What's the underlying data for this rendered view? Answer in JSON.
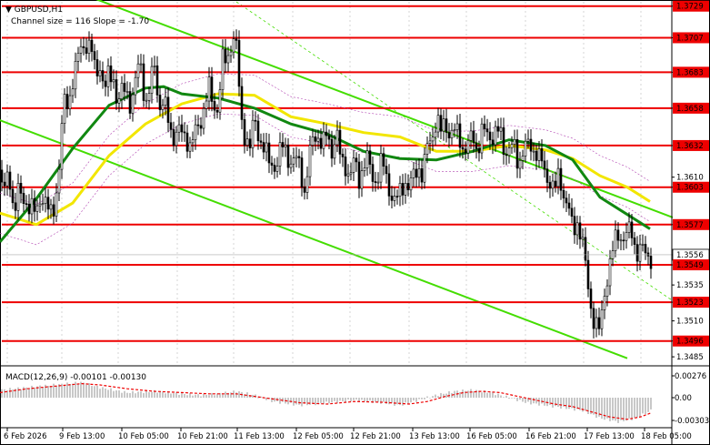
{
  "header": {
    "symbol": "▼ GBPUSD,H1",
    "channel": "Channel size = 116 Slope = -1.70"
  },
  "macd_panel": {
    "label": "MACD(12,26,9) -0.00101 -0.00130",
    "ticks": [
      "0.00276",
      "0.00",
      "-0.00303"
    ]
  },
  "x_axis_labels": [
    "6 Feb 2026",
    "9 Feb 13:00",
    "10 Feb 05:00",
    "10 Feb 21:00",
    "11 Feb 13:00",
    "12 Feb 05:00",
    "12 Feb 21:00",
    "13 Feb 13:00",
    "16 Feb 05:00",
    "16 Feb 21:00",
    "17 Feb 13:00",
    "18 Feb 05:00"
  ],
  "colors": {
    "level": "#ee0000",
    "channel": "#44dd00",
    "ma_green": "#118811",
    "ma_yellow": "#f2e600",
    "candle": "#000000",
    "macd_hist": "#c8c8c8",
    "macd_signal": "#ee0000"
  },
  "chart_data": {
    "type": "candlestick",
    "ylim": [
      1.348,
      1.3732
    ],
    "price_ticks": [
      "1.3729",
      "1.3707",
      "1.3683",
      "1.3658",
      "1.3632",
      "1.3610",
      "1.3603",
      "1.3577",
      "1.3556",
      "1.3549",
      "1.3535",
      "1.3523",
      "1.3510",
      "1.3496",
      "1.3485"
    ],
    "levels": [
      1.3729,
      1.3707,
      1.3683,
      1.3658,
      1.3632,
      1.3603,
      1.3577,
      1.3549,
      1.3523,
      1.3496
    ],
    "current_price": 1.3556,
    "close_path": [
      [
        0,
        1.3615
      ],
      [
        5,
        1.36
      ],
      [
        10,
        1.361
      ],
      [
        15,
        1.359
      ],
      [
        20,
        1.36
      ],
      [
        25,
        1.359
      ],
      [
        30,
        1.3595
      ],
      [
        35,
        1.359
      ],
      [
        40,
        1.358
      ],
      [
        45,
        1.36
      ],
      [
        50,
        1.3595
      ],
      [
        55,
        1.358
      ],
      [
        60,
        1.359
      ],
      [
        65,
        1.362
      ],
      [
        70,
        1.366
      ],
      [
        75,
        1.366
      ],
      [
        80,
        1.368
      ],
      [
        85,
        1.369
      ],
      [
        90,
        1.37
      ],
      [
        95,
        1.3705
      ],
      [
        100,
        1.37
      ],
      [
        105,
        1.368
      ],
      [
        110,
        1.369
      ],
      [
        115,
        1.367
      ],
      [
        120,
        1.368
      ],
      [
        125,
        1.368
      ],
      [
        130,
        1.366
      ],
      [
        135,
        1.367
      ],
      [
        140,
        1.367
      ],
      [
        145,
        1.366
      ],
      [
        150,
        1.368
      ],
      [
        155,
        1.369
      ],
      [
        160,
        1.366
      ],
      [
        165,
        1.367
      ],
      [
        170,
        1.369
      ],
      [
        175,
        1.366
      ],
      [
        180,
        1.366
      ],
      [
        185,
        1.365
      ],
      [
        190,
        1.364
      ],
      [
        195,
        1.364
      ],
      [
        200,
        1.364
      ],
      [
        205,
        1.364
      ],
      [
        210,
        1.363
      ],
      [
        215,
        1.364
      ],
      [
        220,
        1.365
      ],
      [
        225,
        1.366
      ],
      [
        230,
        1.367
      ],
      [
        235,
        1.366
      ],
      [
        240,
        1.366
      ],
      [
        245,
        1.369
      ],
      [
        250,
        1.369
      ],
      [
        255,
        1.371
      ],
      [
        260,
        1.37
      ],
      [
        265,
        1.365
      ],
      [
        270,
        1.364
      ],
      [
        275,
        1.363
      ],
      [
        280,
        1.365
      ],
      [
        285,
        1.364
      ],
      [
        290,
        1.363
      ],
      [
        295,
        1.362
      ],
      [
        300,
        1.362
      ],
      [
        305,
        1.362
      ],
      [
        310,
        1.363
      ],
      [
        315,
        1.363
      ],
      [
        320,
        1.362
      ],
      [
        325,
        1.362
      ],
      [
        330,
        1.362
      ],
      [
        335,
        1.36
      ],
      [
        340,
        1.362
      ],
      [
        345,
        1.364
      ],
      [
        350,
        1.364
      ],
      [
        355,
        1.363
      ],
      [
        360,
        1.364
      ],
      [
        365,
        1.363
      ],
      [
        370,
        1.364
      ],
      [
        375,
        1.362
      ],
      [
        380,
        1.362
      ],
      [
        385,
        1.361
      ],
      [
        390,
        1.362
      ],
      [
        395,
        1.361
      ],
      [
        400,
        1.362
      ],
      [
        405,
        1.362
      ],
      [
        410,
        1.361
      ],
      [
        415,
        1.361
      ],
      [
        420,
        1.362
      ],
      [
        425,
        1.361
      ],
      [
        430,
        1.36
      ],
      [
        435,
        1.359
      ],
      [
        440,
        1.36
      ],
      [
        445,
        1.361
      ],
      [
        450,
        1.36
      ],
      [
        455,
        1.361
      ],
      [
        460,
        1.362
      ],
      [
        465,
        1.361
      ],
      [
        470,
        1.363
      ],
      [
        475,
        1.364
      ],
      [
        480,
        1.365
      ],
      [
        485,
        1.364
      ],
      [
        490,
        1.365
      ],
      [
        495,
        1.364
      ],
      [
        500,
        1.364
      ],
      [
        505,
        1.364
      ],
      [
        510,
        1.363
      ],
      [
        515,
        1.363
      ],
      [
        520,
        1.364
      ],
      [
        525,
        1.363
      ],
      [
        530,
        1.364
      ],
      [
        535,
        1.364
      ],
      [
        540,
        1.364
      ],
      [
        545,
        1.364
      ],
      [
        550,
        1.364
      ],
      [
        555,
        1.363
      ],
      [
        560,
        1.363
      ],
      [
        565,
        1.363
      ],
      [
        570,
        1.362
      ],
      [
        575,
        1.363
      ],
      [
        580,
        1.363
      ],
      [
        585,
        1.363
      ],
      [
        590,
        1.363
      ],
      [
        595,
        1.362
      ],
      [
        600,
        1.361
      ],
      [
        605,
        1.361
      ],
      [
        610,
        1.36
      ],
      [
        615,
        1.361
      ],
      [
        620,
        1.36
      ],
      [
        625,
        1.359
      ],
      [
        630,
        1.357
      ],
      [
        635,
        1.358
      ],
      [
        640,
        1.357
      ],
      [
        645,
        1.354
      ],
      [
        650,
        1.352
      ],
      [
        655,
        1.351
      ],
      [
        660,
        1.35
      ],
      [
        665,
        1.353
      ],
      [
        670,
        1.355
      ],
      [
        675,
        1.356
      ],
      [
        680,
        1.357
      ],
      [
        685,
        1.357
      ],
      [
        690,
        1.357
      ],
      [
        695,
        1.357
      ],
      [
        700,
        1.356
      ],
      [
        705,
        1.356
      ],
      [
        710,
        1.3555
      ],
      [
        716,
        1.3556
      ]
    ],
    "ma_green": [
      [
        0,
        1.3565
      ],
      [
        40,
        1.3595
      ],
      [
        80,
        1.363
      ],
      [
        120,
        1.366
      ],
      [
        160,
        1.3672
      ],
      [
        180,
        1.3673
      ],
      [
        200,
        1.3668
      ],
      [
        240,
        1.3665
      ],
      [
        280,
        1.3658
      ],
      [
        320,
        1.3647
      ],
      [
        360,
        1.364
      ],
      [
        400,
        1.3628
      ],
      [
        440,
        1.3623
      ],
      [
        480,
        1.3622
      ],
      [
        520,
        1.3628
      ],
      [
        560,
        1.3636
      ],
      [
        600,
        1.3632
      ],
      [
        630,
        1.3622
      ],
      [
        660,
        1.3596
      ],
      [
        690,
        1.3584
      ],
      [
        715,
        1.3574
      ]
    ],
    "ma_yellow": [
      [
        0,
        1.3585
      ],
      [
        40,
        1.3577
      ],
      [
        80,
        1.3592
      ],
      [
        120,
        1.3625
      ],
      [
        160,
        1.3647
      ],
      [
        200,
        1.3661
      ],
      [
        240,
        1.3668
      ],
      [
        280,
        1.3667
      ],
      [
        320,
        1.3652
      ],
      [
        360,
        1.3647
      ],
      [
        400,
        1.3641
      ],
      [
        440,
        1.3638
      ],
      [
        480,
        1.3628
      ],
      [
        520,
        1.3628
      ],
      [
        560,
        1.3632
      ],
      [
        600,
        1.3629
      ],
      [
        630,
        1.3623
      ],
      [
        660,
        1.3611
      ],
      [
        690,
        1.3603
      ],
      [
        715,
        1.3593
      ]
    ],
    "channel_upper": [
      [
        105,
        1.3734
      ],
      [
        740,
        1.3582
      ]
    ],
    "channel_lower": [
      [
        -6,
        1.3651
      ],
      [
        690,
        1.3484
      ]
    ],
    "channel_mid": [
      [
        260,
        1.3732
      ],
      [
        740,
        1.3524
      ]
    ],
    "macd_hist_profile": [
      [
        0,
        0.3
      ],
      [
        30,
        0.4
      ],
      [
        60,
        0.5
      ],
      [
        90,
        0.6
      ],
      [
        110,
        0.4
      ],
      [
        140,
        0.2
      ],
      [
        170,
        0.25
      ],
      [
        200,
        0.15
      ],
      [
        220,
        0.1
      ],
      [
        240,
        0.15
      ],
      [
        260,
        0.25
      ],
      [
        280,
        0.1
      ],
      [
        300,
        -0.15
      ],
      [
        330,
        -0.3
      ],
      [
        360,
        -0.2
      ],
      [
        390,
        -0.1
      ],
      [
        420,
        -0.2
      ],
      [
        440,
        -0.3
      ],
      [
        460,
        -0.1
      ],
      [
        480,
        0.1
      ],
      [
        500,
        0.25
      ],
      [
        520,
        0.3
      ],
      [
        540,
        0.2
      ],
      [
        560,
        0.0
      ],
      [
        580,
        -0.2
      ],
      [
        600,
        -0.3
      ],
      [
        620,
        -0.4
      ],
      [
        640,
        -0.5
      ],
      [
        660,
        -0.8
      ],
      [
        680,
        -0.95
      ],
      [
        700,
        -0.8
      ],
      [
        716,
        -0.5
      ]
    ],
    "macd_signal_profile": [
      [
        0,
        0.2
      ],
      [
        30,
        0.35
      ],
      [
        60,
        0.45
      ],
      [
        90,
        0.55
      ],
      [
        110,
        0.5
      ],
      [
        140,
        0.35
      ],
      [
        170,
        0.25
      ],
      [
        200,
        0.2
      ],
      [
        230,
        0.15
      ],
      [
        260,
        0.15
      ],
      [
        280,
        0.05
      ],
      [
        300,
        -0.05
      ],
      [
        330,
        -0.2
      ],
      [
        360,
        -0.25
      ],
      [
        390,
        -0.15
      ],
      [
        420,
        -0.18
      ],
      [
        450,
        -0.25
      ],
      [
        470,
        -0.15
      ],
      [
        490,
        0.05
      ],
      [
        510,
        0.2
      ],
      [
        530,
        0.25
      ],
      [
        550,
        0.2
      ],
      [
        570,
        0.05
      ],
      [
        590,
        -0.1
      ],
      [
        610,
        -0.25
      ],
      [
        630,
        -0.35
      ],
      [
        650,
        -0.55
      ],
      [
        670,
        -0.75
      ],
      [
        690,
        -0.85
      ],
      [
        705,
        -0.75
      ],
      [
        716,
        -0.6
      ]
    ]
  }
}
